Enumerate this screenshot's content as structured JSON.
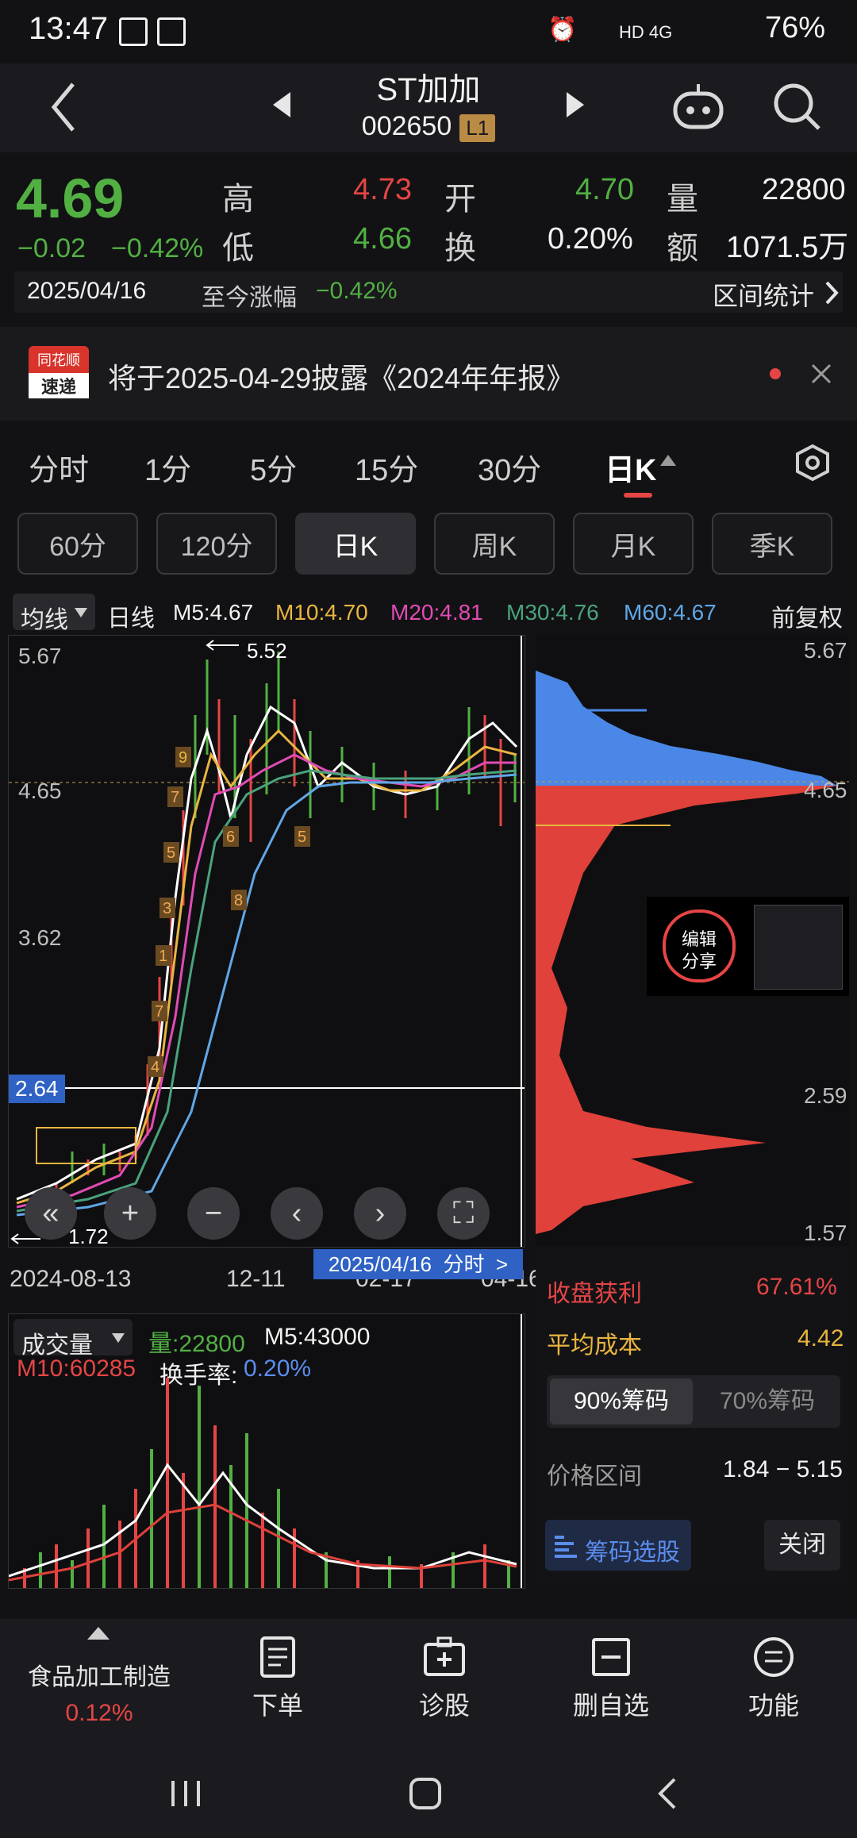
{
  "status_bar": {
    "time": "13:47",
    "network": "HD 4G",
    "battery": "76%"
  },
  "header": {
    "title": "ST加加",
    "code": "002650",
    "level_badge": "L1"
  },
  "quote": {
    "price": "4.69",
    "change": "−0.02",
    "change_pct": "−0.42%",
    "fields": [
      {
        "label": "高",
        "value": "4.73"
      },
      {
        "label": "开",
        "value": "4.70"
      },
      {
        "label": "量",
        "value": "22800"
      },
      {
        "label": "低",
        "value": "4.66"
      },
      {
        "label": "换",
        "value": "0.20%"
      },
      {
        "label": "额",
        "value": "1071.5万"
      }
    ]
  },
  "date_row": {
    "date": "2025/04/16",
    "since_label": "至今涨幅",
    "since_value": "−0.42%",
    "stats_label": "区间统计"
  },
  "notice": {
    "logo_top": "同花顺",
    "logo_bottom": "速递",
    "text": "将于2025-04-29披露《2024年年报》"
  },
  "period_tabs": [
    "分时",
    "1分",
    "5分",
    "15分",
    "30分",
    "日K"
  ],
  "sub_tabs": [
    "60分",
    "120分",
    "日K",
    "周K",
    "月K",
    "季K"
  ],
  "ma_row": {
    "selector": "均线",
    "kind": "日线",
    "items": [
      {
        "label": "M5:4.67",
        "color": "#f2f2f2"
      },
      {
        "label": "M10:4.70",
        "color": "#e9b540"
      },
      {
        "label": "M20:4.81",
        "color": "#e14bb5"
      },
      {
        "label": "M30:4.76",
        "color": "#4aa37d"
      },
      {
        "label": "M60:4.67",
        "color": "#60a7e6"
      }
    ],
    "adjust": "前复权"
  },
  "kline": {
    "y_labels": [
      "5.67",
      "4.65",
      "3.62",
      "2.64"
    ],
    "high_mark": "5.52",
    "low_mark": "1.72",
    "x_labels": [
      "2024-08-13",
      "12-11",
      "02-17",
      "04-16"
    ],
    "popup": "2025/04/16  分时  >"
  },
  "chip_panel": {
    "y_labels": [
      "5.67",
      "4.65",
      "2.59",
      "1.57"
    ],
    "share_btn_line1": "编辑",
    "share_btn_line2": "分享",
    "profit_label": "收盘获利",
    "profit_value": "67.61%",
    "cost_label": "平均成本",
    "cost_value": "4.42",
    "chip_tab_a": "90%筹码",
    "chip_tab_b": "70%筹码",
    "range_label": "价格区间",
    "range_value": "1.84 − 5.15",
    "select_btn": "筹码选股",
    "close_btn": "关闭"
  },
  "volume": {
    "selector": "成交量",
    "vol": "量:22800",
    "m5": "M5:43000",
    "m10": "M10:60285",
    "turnover_label": "换手率:",
    "turnover_value": "0.20%"
  },
  "bottom_nav": {
    "sector": "食品加工制造",
    "sector_pct": "0.12%",
    "items": [
      "下单",
      "诊股",
      "删自选",
      "功能"
    ]
  }
}
